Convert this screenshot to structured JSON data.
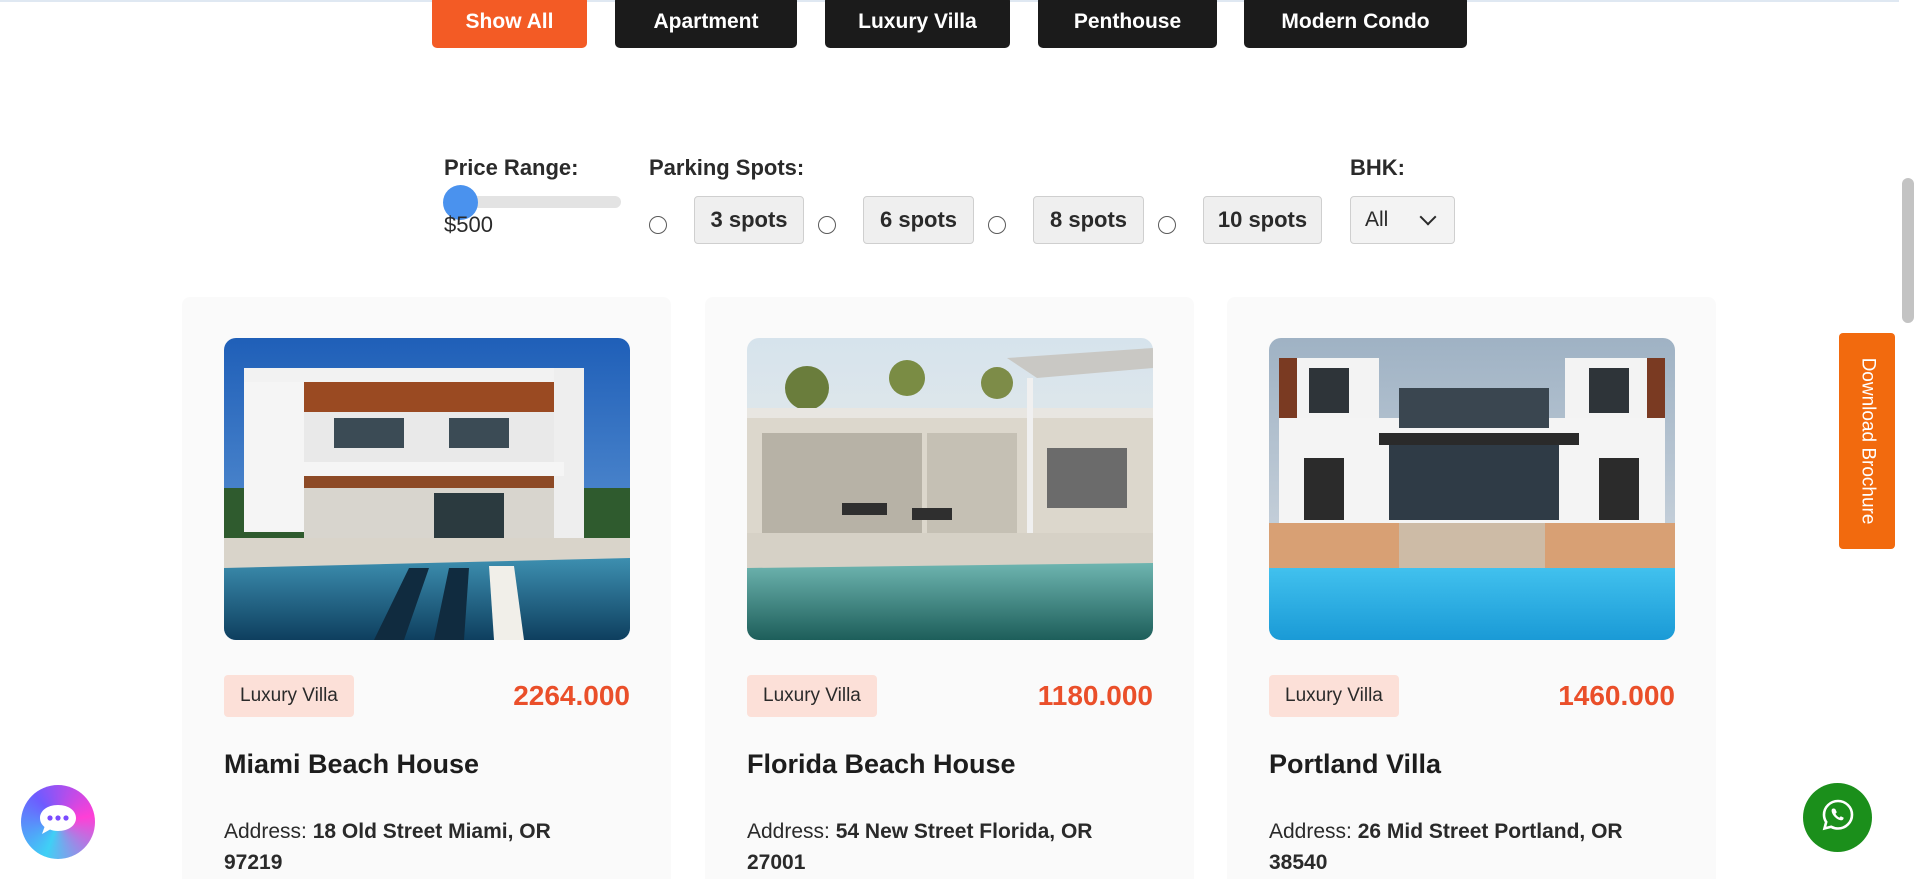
{
  "filters": {
    "tabs": [
      {
        "label": "Show All",
        "active": true
      },
      {
        "label": "Apartment",
        "active": false
      },
      {
        "label": "Luxury Villa",
        "active": false
      },
      {
        "label": "Penthouse",
        "active": false
      },
      {
        "label": "Modern Condo",
        "active": false
      }
    ],
    "price_label": "Price Range:",
    "price_value": "$500",
    "parking_label": "Parking Spots:",
    "parking_options": [
      "3 spots",
      "6 spots",
      "8 spots",
      "10 spots"
    ],
    "bhk_label": "BHK:",
    "bhk_selected": "All"
  },
  "listings": [
    {
      "category": "Luxury Villa",
      "price": "2264.000",
      "title": "Miami Beach House",
      "address_label": "Address:",
      "address": "18 Old Street Miami, OR 97219"
    },
    {
      "category": "Luxury Villa",
      "price": "1180.000",
      "title": "Florida Beach House",
      "address_label": "Address:",
      "address": "54 New Street Florida, OR 27001"
    },
    {
      "category": "Luxury Villa",
      "price": "1460.000",
      "title": "Portland Villa",
      "address_label": "Address:",
      "address": "26 Mid Street Portland, OR 38540"
    }
  ],
  "side": {
    "brochure_label": "Download Brochure"
  },
  "icons": {
    "chat": "chat-icon",
    "whatsapp": "whatsapp-icon",
    "chevron": "chevron-down-icon"
  },
  "colors": {
    "accent": "#f35b25",
    "price": "#ea4f2a",
    "badge_bg": "#fce0d8",
    "dark_button": "#1b1b1b",
    "brochure": "#f26a0e",
    "whatsapp": "#1b8f1b",
    "slider_thumb": "#4a92ee"
  }
}
